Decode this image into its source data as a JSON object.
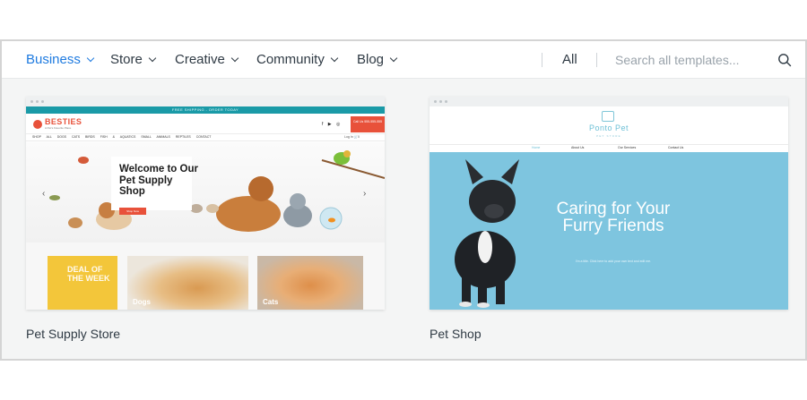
{
  "nav": {
    "items": [
      {
        "label": "Business",
        "active": true
      },
      {
        "label": "Store",
        "active": false
      },
      {
        "label": "Creative",
        "active": false
      },
      {
        "label": "Community",
        "active": false
      },
      {
        "label": "Blog",
        "active": false
      }
    ],
    "all_label": "All",
    "search_placeholder": "Search all templates...",
    "search_icon": "search-icon",
    "accent_color": "#1f7be0"
  },
  "templates": [
    {
      "title": "Pet Supply Store",
      "preview": {
        "shipping_banner": "FREE SHIPPING - ORDER TODAY",
        "logo": "BESTIES",
        "logo_tagline": "A Pet's Favorite Place",
        "social": "f ▶ ◎",
        "call_button": "Call Us 555-555-555",
        "menu": "SHOP ALL  DOGS  CATS  BIRDS  FISH & AQUATICS  SMALL ANIMALS  REPTILES  CONTACT",
        "login": "Log In  🛒0",
        "hero_heading": "Welcome to Our Pet Supply Shop",
        "hero_button": "Shop Now",
        "arrow_left": "‹",
        "arrow_right": "›",
        "deal": "DEAL OF THE WEEK",
        "tile_dogs": "Dogs",
        "tile_cats": "Cats"
      }
    },
    {
      "title": "Pet Shop",
      "preview": {
        "logo": "Ponto Pet",
        "logo_sub": "PET STORE",
        "menu": [
          "Home",
          "About Us",
          "Our Services",
          "Contact Us"
        ],
        "hero_heading": "Caring for Your Furry Friends",
        "hero_sub": "I'm a title. Click here to add your own text and edit me."
      }
    }
  ]
}
